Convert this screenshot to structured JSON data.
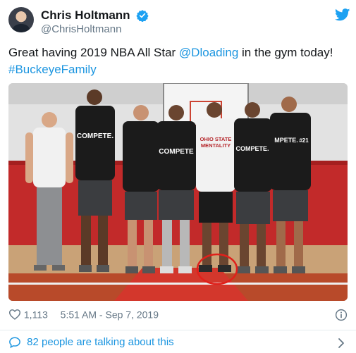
{
  "tweet": {
    "display_name": "Chris Holtmann",
    "handle": "@ChrisHoltmann",
    "text_parts": {
      "before": "Great having 2019 NBA All Star ",
      "mention": "@Dloading",
      "middle": " in the gym today! ",
      "hashtag": "#BuckeyeFamily"
    },
    "photo": {
      "shirt_text_1": "COMPETE.",
      "shirt_text_2": "COMPETE",
      "shirt_text_3": "OHIO STATE",
      "shirt_text_4": "MENTALITY",
      "shirt_text_5": "COMPETE.",
      "shirt_text_6": "MPETE.",
      "jersey_number": "#21"
    },
    "likes": "1,113",
    "timestamp": "5:51 AM - Sep 7, 2019",
    "talking": "82 people are talking about this"
  },
  "colors": {
    "link": "#1b95e0",
    "verified": "#1da1f2",
    "secondary_text": "#657786",
    "circle_annotation": "#e0201b"
  },
  "icons": [
    "verified-badge-icon",
    "twitter-bird-icon",
    "heart-icon",
    "info-icon",
    "comment-bubble-icon",
    "chevron-right-icon"
  ]
}
